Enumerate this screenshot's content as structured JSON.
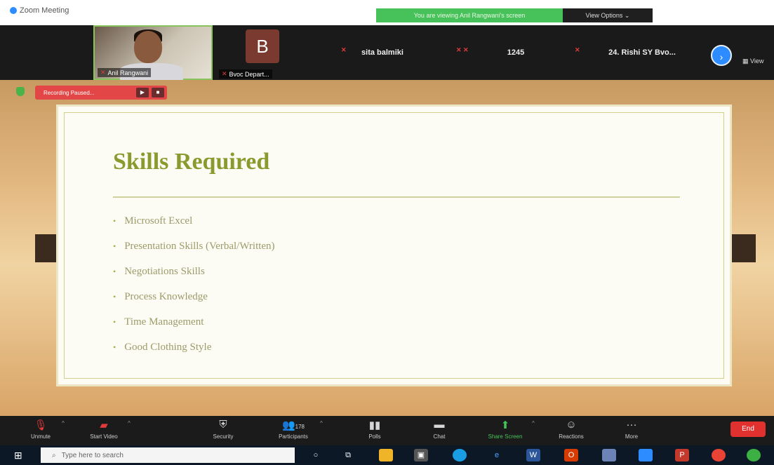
{
  "window": {
    "title": "Zoom Meeting"
  },
  "banner": {
    "viewing": "You are viewing Anil Rangwani's screen",
    "view_options": "View Options ⌄"
  },
  "participants": {
    "tiles": [
      {
        "name": "Anil Rangwani"
      },
      {
        "name": "Bvoc Depart...",
        "initial": "B"
      },
      {
        "name": "sita balmiki"
      },
      {
        "name": "1245"
      },
      {
        "name": "24. Rishi SY Bvo..."
      }
    ],
    "view_label": "View"
  },
  "recording": {
    "label": "Recording Paused..."
  },
  "slide": {
    "title": "Skills Required",
    "bullets": [
      "Microsoft Excel",
      "Presentation Skills (Verbal/Written)",
      "Negotiations Skills",
      "Process Knowledge",
      "Time Management",
      "Good Clothing Style"
    ]
  },
  "controls": {
    "unmute": "Unmute",
    "start_video": "Start Video",
    "security": "Security",
    "participants": "Participants",
    "participant_count": "178",
    "polls": "Polls",
    "chat": "Chat",
    "share_screen": "Share Screen",
    "reactions": "Reactions",
    "more": "More",
    "end": "End"
  },
  "taskbar": {
    "search_placeholder": "Type here to search"
  },
  "colors": {
    "accent": "#2d8cff",
    "share_green": "#46c25a",
    "end_red": "#e0312f",
    "slide_title": "#8a9a2e"
  }
}
